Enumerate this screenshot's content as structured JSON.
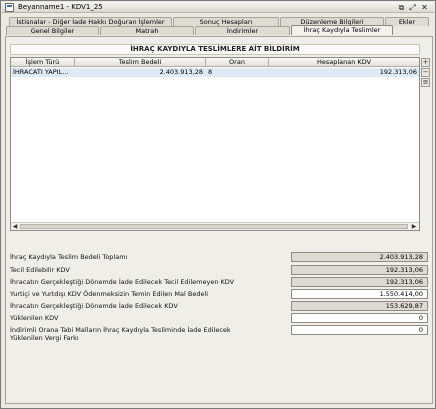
{
  "window": {
    "title": "Beyanname1 - KDV1_25"
  },
  "tabs": {
    "row1": [
      "İstisnalar - Diğer İade Hakkı Doğuran İşlemler",
      "Sonuç Hesapları",
      "Düzenleme Bilgileri",
      "Ekler"
    ],
    "row2": [
      "Genel Bilgiler",
      "Matrah",
      "İndirimler",
      "İhraç Kaydıyla Teslimler"
    ],
    "active": "İhraç Kaydıyla Teslimler"
  },
  "section": {
    "title": "İHRAÇ KAYDIYLA TESLİMLERE AİT BİLDİRİM"
  },
  "table": {
    "columns": [
      "İşlem Türü",
      "Teslim Bedeli",
      "Oran",
      "Hesaplanan KDV"
    ],
    "rows": [
      [
        "İHRACATI YAPIL...",
        "2.403.913,28",
        "8",
        "192.313,06"
      ]
    ]
  },
  "summary": [
    {
      "label": "İhraç Kaydıyla Teslim Bedeli Toplamı",
      "value": "2.403.913,28"
    },
    {
      "label": "Tecil Edilebilir KDV",
      "value": "192.313,06"
    },
    {
      "label": "İhracatın Gerçekleştiği Dönemde İade Edilecek Tecil Edilemeyen KDV",
      "value": "192.313,06"
    },
    {
      "label": "Yurtiçi ve Yurtdışı KDV Ödenmeksizin Temin Edilen Mal Bedeli",
      "value": "1.550.414,00"
    },
    {
      "label": "İhracatın Gerçekleştiği Dönemde İade Edilecek KDV",
      "value": "153.629,87"
    },
    {
      "label": "Yüklenilen KDV",
      "value": "0"
    },
    {
      "label": "İndirimli Orana Tabi Malların İhraç Kaydıyla Tesliminde İade Edilecek Yüklenilen Vergi Farkı",
      "value": "0"
    }
  ]
}
